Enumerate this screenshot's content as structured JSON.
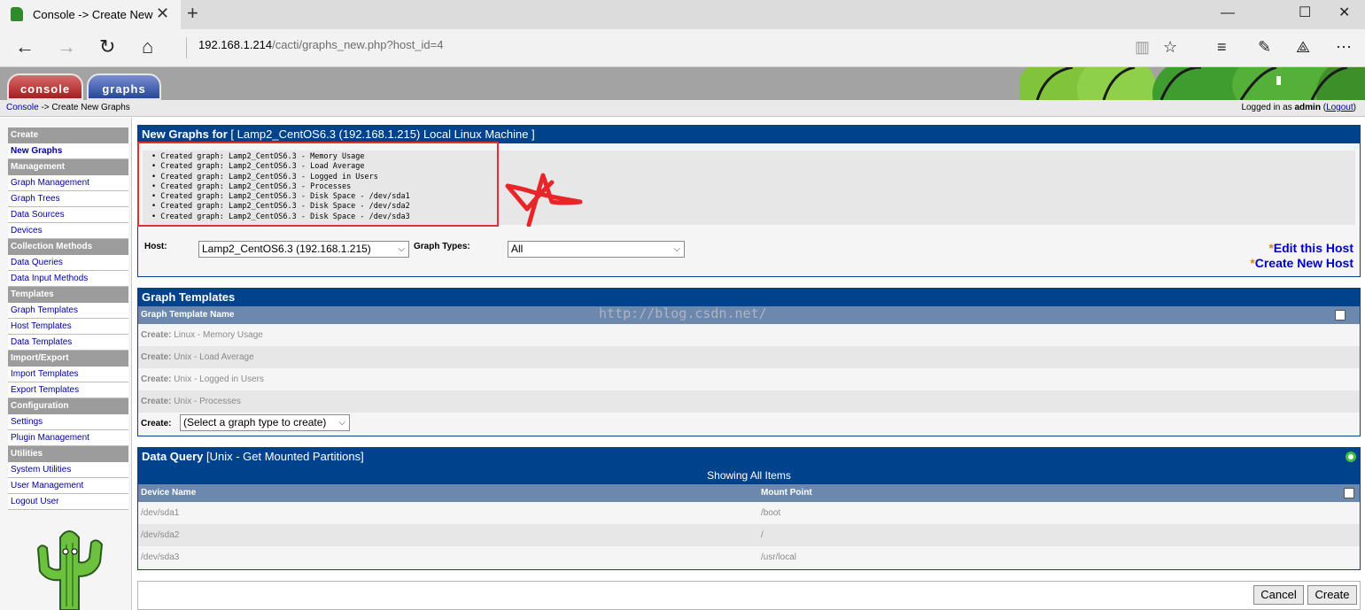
{
  "browser": {
    "tab_title": "Console -> Create New",
    "url_host": "192.168.1.214",
    "url_path": "/cacti/graphs_new.php?host_id=4"
  },
  "cacti": {
    "tabs": {
      "console": "console",
      "graphs": "graphs"
    },
    "breadcrumb": {
      "link": "Console",
      "rest": " -> Create New Graphs"
    },
    "login": {
      "prefix": "Logged in as ",
      "user": "admin",
      "logout": "Logout"
    }
  },
  "sidebar": {
    "sections": [
      {
        "head": "Create",
        "items": [
          {
            "label": "New Graphs",
            "active": true
          }
        ]
      },
      {
        "head": "Management",
        "items": [
          {
            "label": "Graph Management"
          },
          {
            "label": "Graph Trees"
          },
          {
            "label": "Data Sources"
          },
          {
            "label": "Devices"
          }
        ]
      },
      {
        "head": "Collection Methods",
        "items": [
          {
            "label": "Data Queries"
          },
          {
            "label": "Data Input Methods"
          }
        ]
      },
      {
        "head": "Templates",
        "items": [
          {
            "label": "Graph Templates"
          },
          {
            "label": "Host Templates"
          },
          {
            "label": "Data Templates"
          }
        ]
      },
      {
        "head": "Import/Export",
        "items": [
          {
            "label": "Import Templates"
          },
          {
            "label": "Export Templates"
          }
        ]
      },
      {
        "head": "Configuration",
        "items": [
          {
            "label": "Settings"
          },
          {
            "label": "Plugin Management"
          }
        ]
      },
      {
        "head": "Utilities",
        "items": [
          {
            "label": "System Utilities"
          },
          {
            "label": "User Management"
          },
          {
            "label": "Logout User"
          }
        ]
      }
    ]
  },
  "newgraphs": {
    "title_bold": "New Graphs for",
    "title_rest": " [ Lamp2_CentOS6.3 (192.168.1.215) Local Linux Machine ]",
    "messages": [
      "Created graph: Lamp2_CentOS6.3 - Memory Usage",
      "Created graph: Lamp2_CentOS6.3 - Load Average",
      "Created graph: Lamp2_CentOS6.3 - Logged in Users",
      "Created graph: Lamp2_CentOS6.3 - Processes",
      "Created graph: Lamp2_CentOS6.3 - Disk Space - /dev/sda1",
      "Created graph: Lamp2_CentOS6.3 - Disk Space - /dev/sda2",
      "Created graph: Lamp2_CentOS6.3 - Disk Space - /dev/sda3"
    ],
    "host_label": "Host:",
    "host_value": "Lamp2_CentOS6.3 (192.168.1.215)",
    "graph_types_label": "Graph Types:",
    "graph_types_value": "All",
    "edit_host": "Edit this Host",
    "create_host": "Create New Host",
    "asterisk": "*"
  },
  "graph_templates": {
    "title": "Graph Templates",
    "column": "Graph Template Name",
    "rows": [
      {
        "prefix": "Create:",
        "name": " Linux - Memory Usage"
      },
      {
        "prefix": "Create:",
        "name": " Unix - Load Average"
      },
      {
        "prefix": "Create:",
        "name": " Unix - Logged in Users"
      },
      {
        "prefix": "Create:",
        "name": " Unix - Processes"
      }
    ],
    "create_label": "Create:",
    "create_select": "(Select a graph type to create)"
  },
  "data_query": {
    "title_bold": "Data Query",
    "title_rest": " [Unix - Get Mounted Partitions]",
    "showing": "Showing All Items",
    "col_device": "Device Name",
    "col_mount": "Mount Point",
    "rows": [
      {
        "device": "/dev/sda1",
        "mount": "/boot"
      },
      {
        "device": "/dev/sda2",
        "mount": "/"
      },
      {
        "device": "/dev/sda3",
        "mount": "/usr/local"
      }
    ]
  },
  "buttons": {
    "cancel": "Cancel",
    "create": "Create"
  },
  "watermark": "http://blog.csdn.net/",
  "colors": {
    "header_blue": "#00438c",
    "subheader": "#6d88ad",
    "annotation_red": "#e03030"
  }
}
